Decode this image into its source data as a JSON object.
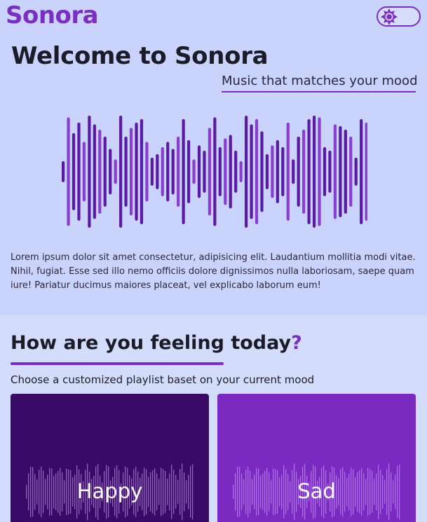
{
  "brand": {
    "name": "Sonora"
  },
  "theme_toggle": {
    "icon": "sun-icon",
    "state": "light"
  },
  "hero": {
    "title": "Welcome to Sonora",
    "tagline": "Music that matches your mood",
    "description": "Lorem ipsum dolor sit amet consectetur, adipisicing elit. Laudantium mollitia modi vitae. Nihil, fugiat. Esse sed illo nemo officiis dolore dignissimos nulla laboriosam, saepe quam iure! Pariatur ducimus maiores placeat, vel explicabo laborum eum!"
  },
  "mood": {
    "title": "How are you feeling today",
    "title_mark": "?",
    "subtitle": "Choose a customized playlist baset on your current mood",
    "cards": [
      {
        "label": "Happy",
        "color": "#3a0b66"
      },
      {
        "label": "Sad",
        "color": "#7b2ac1"
      }
    ]
  },
  "colors": {
    "accent": "#7a2fc2",
    "wave_dark": "#5a1aa3",
    "wave_light": "#8a3dd0",
    "hero_bg": "#c9d3fb",
    "page_bg": "#d4dcfb"
  }
}
